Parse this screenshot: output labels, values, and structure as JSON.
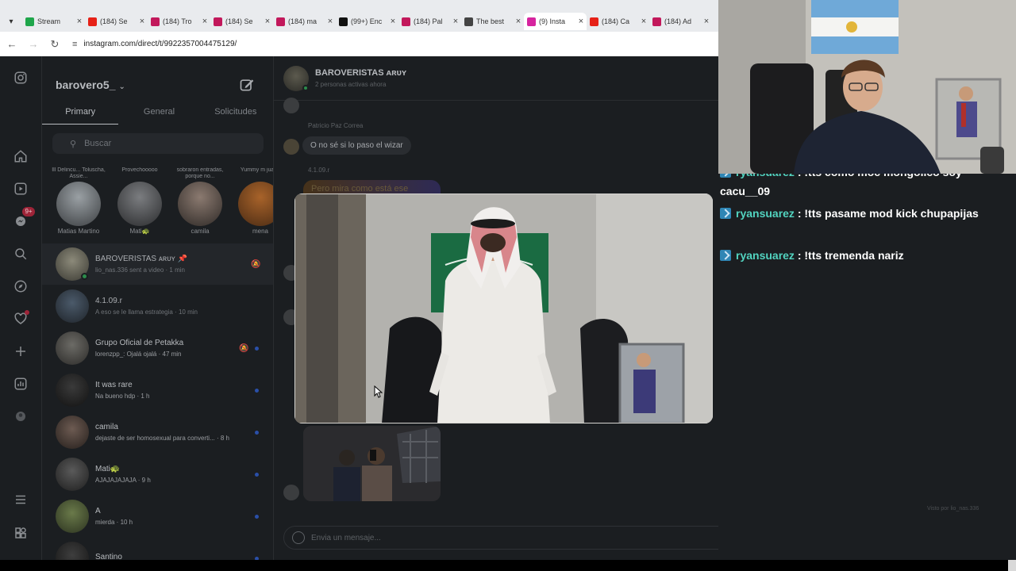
{
  "browser": {
    "tabs": [
      {
        "label": "Stream",
        "favicon": "#1fa64b"
      },
      {
        "label": "(184) Se",
        "favicon": "#e62117"
      },
      {
        "label": "(184) Tro",
        "favicon": "#c2185b"
      },
      {
        "label": "(184) Se",
        "favicon": "#c2185b"
      },
      {
        "label": "(184) ma",
        "favicon": "#c2185b"
      },
      {
        "label": "(99+) Enc",
        "favicon": "#111111"
      },
      {
        "label": "(184) Pal",
        "favicon": "#c2185b"
      },
      {
        "label": "The best",
        "favicon": "#444444"
      },
      {
        "label": "(9) Insta",
        "favicon": "#d6249f"
      },
      {
        "label": "(184) Ca",
        "favicon": "#e62117"
      },
      {
        "label": "(184) Ad",
        "favicon": "#c2185b"
      }
    ],
    "active_tab_index": 8,
    "url": "instagram.com/direct/t/9922357004475129/"
  },
  "inbox": {
    "username": "barovero5_",
    "tabs": [
      "Primary",
      "General",
      "Solicitudes"
    ],
    "search_placeholder": "Buscar",
    "notes": [
      {
        "bubble": "Ill Delincu... Toluscha, Assie...",
        "name": "Matias Martino"
      },
      {
        "bubble": "Provechooooo",
        "name": "Mati🐢"
      },
      {
        "bubble": "sobraron entradas, porque no...",
        "name": "camila"
      },
      {
        "bubble": "Yummy m juane",
        "name": "mena"
      }
    ],
    "conversations": [
      {
        "name": "BAROVERISTAS ᴀʀᴜʏ 📌",
        "preview": "lio_nas.336 sent a video · 1 min",
        "selected": true
      },
      {
        "name": "4.1.09.r",
        "preview": "A eso se le llama estrategia · 10 min"
      },
      {
        "name": "Grupo Oficial de Petakka",
        "preview": "lorenzpp_: Ojalá ojalá · 47 min"
      },
      {
        "name": "It was rare",
        "preview": "Na bueno hdp · 1 h"
      },
      {
        "name": "camila",
        "preview": "dejaste de ser homosexual para converti... · 8 h"
      },
      {
        "name": "Mati🐢",
        "preview": "AJAJAJAJAJA · 9 h"
      },
      {
        "name": "A",
        "preview": "mierda · 10 h"
      },
      {
        "name": "Santino",
        "preview": ""
      }
    ],
    "rail_badge": "9+"
  },
  "thread": {
    "name": "BAROVERISTAS ᴀʀᴜʏ",
    "status": "2 personas activas ahora",
    "messages": [
      {
        "sender": "Patricio Paz Correa",
        "text": "O no sé si lo paso el wizar"
      },
      {
        "sender": "4.1.09.r",
        "text": "Pero mira como está ese"
      }
    ],
    "seen": "Visto por lio_nas.336",
    "composer_placeholder": "Envia un mensaje..."
  },
  "chat": [
    {
      "user": "ryansuarez",
      "text": " : !tts como moc mongolico soy cacu__09"
    },
    {
      "user": "ryansuarez",
      "text": " : !tts pasame mod kick chupapijas"
    },
    {
      "user": "ryansuarez",
      "text": " : !tts tremenda nariz"
    }
  ]
}
